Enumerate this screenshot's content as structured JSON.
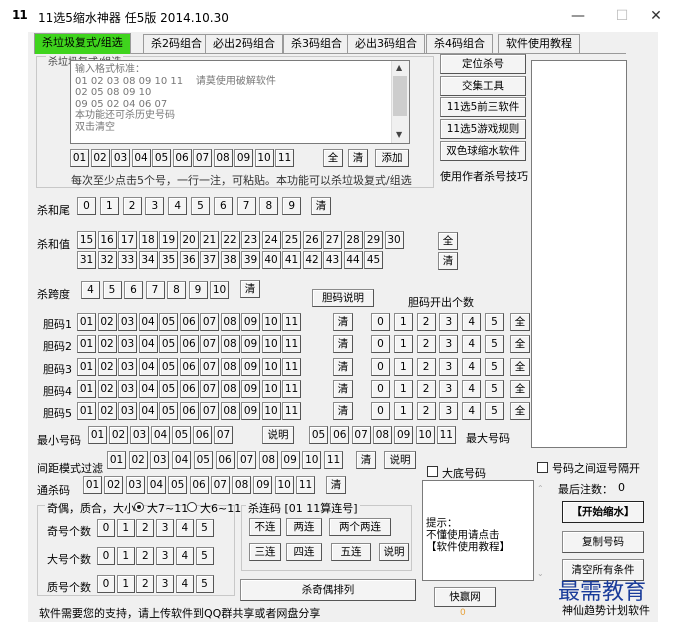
{
  "window": {
    "app_icon": "11",
    "title": "11选5缩水神器 任5版 2014.10.30",
    "min": "—",
    "max": "☐",
    "close": "✕"
  },
  "tabs": [
    "杀垃圾复式/组选",
    "杀2码组合",
    "必出2码组合",
    "杀3码组合",
    "必出3码组合",
    "杀4码组合",
    "软件使用教程"
  ],
  "group1_title": "杀垃圾复式/组选",
  "input_text": "输入格式标准：\n01 02 03 08 09 10 11    请莫使用破解软件\n02 05 08 09 10\n09 05 02 04 06 07\n本功能还可杀历史号码\n双击清空",
  "numbers11": [
    "01",
    "02",
    "03",
    "04",
    "05",
    "06",
    "07",
    "08",
    "09",
    "10",
    "11"
  ],
  "row1_btns": {
    "all": "全",
    "clear": "清",
    "add": "添加"
  },
  "hint_line": "每次至少点击5个号，一行一注，可粘贴。本功能可以杀垃圾复式/组选",
  "right_buttons": [
    "定位杀号",
    "交集工具",
    "11选5前三软件",
    "11选5游戏规则",
    "双色球缩水软件"
  ],
  "author_hint": "使用作者杀号技巧",
  "sum_tail": {
    "label": "杀和尾",
    "values": [
      "0",
      "1",
      "2",
      "3",
      "4",
      "5",
      "6",
      "7",
      "8",
      "9"
    ],
    "clear": "清"
  },
  "sum_value": {
    "label": "杀和值",
    "row1": [
      "15",
      "16",
      "17",
      "18",
      "19",
      "20",
      "21",
      "22",
      "23",
      "24",
      "25",
      "26",
      "27",
      "28",
      "29",
      "30"
    ],
    "row2": [
      "31",
      "32",
      "33",
      "34",
      "35",
      "36",
      "37",
      "38",
      "39",
      "40",
      "41",
      "42",
      "43",
      "44",
      "45"
    ],
    "all": "全",
    "clear": "清"
  },
  "span": {
    "label": "杀跨度",
    "values": [
      "4",
      "5",
      "6",
      "7",
      "8",
      "9",
      "10"
    ],
    "clear": "清"
  },
  "dan_help": "胆码说明",
  "dan_count_title": "胆码开出个数",
  "dan_rows": [
    "胆码1",
    "胆码2",
    "胆码3",
    "胆码4",
    "胆码5"
  ],
  "dan_clear": "清",
  "dan_counts": [
    "0",
    "1",
    "2",
    "3",
    "4",
    "5"
  ],
  "dan_all": "全",
  "min_label": "最小号码",
  "min_values": [
    "01",
    "02",
    "03",
    "04",
    "05",
    "06",
    "07"
  ],
  "minmax_help": "说明",
  "max_values": [
    "05",
    "06",
    "07",
    "08",
    "09",
    "10",
    "11"
  ],
  "max_label": "最大号码",
  "gap": {
    "label": "间距模式过滤",
    "values": [
      "01",
      "02",
      "03",
      "04",
      "05",
      "06",
      "07",
      "08",
      "09",
      "10",
      "11"
    ],
    "clear": "清",
    "help": "说明"
  },
  "big_bottom_label": "大底号码",
  "through": {
    "label": "通杀码",
    "values": [
      "01",
      "02",
      "03",
      "04",
      "05",
      "06",
      "07",
      "08",
      "09",
      "10",
      "11"
    ],
    "clear": "清"
  },
  "parity": {
    "title": "奇偶，质合，大小",
    "opt1": "大7~11",
    "opt2": "大6~11",
    "rows": [
      "奇号个数",
      "大号个数",
      "质号个数"
    ],
    "values": [
      "0",
      "1",
      "2",
      "3",
      "4",
      "5"
    ]
  },
  "lian": {
    "title": "杀连码 [01 11算连号]",
    "btns1": [
      "不连",
      "两连",
      "两个两连"
    ],
    "btns2": [
      "三连",
      "四连",
      "五连"
    ],
    "help": "说明"
  },
  "odd_even_btn": "杀奇偶排列",
  "tip_text": "提示：\n不懂使用请点击\n【软件使用教程】",
  "right_panel": {
    "checkbox_label": "号码之间逗号隔开",
    "last_count": "最后注数：",
    "last_count_value": "0",
    "start": "【开始缩水】",
    "copy": "复制号码",
    "clear_all": "清空所有条件"
  },
  "quick_net": "快赢网",
  "footer_left": "软件需要您的支持，请上传软件到QQ群共享或者网盘分享",
  "footer_right": "神仙趋势计划软件",
  "footer_small": "0",
  "watermark": "最需教育"
}
